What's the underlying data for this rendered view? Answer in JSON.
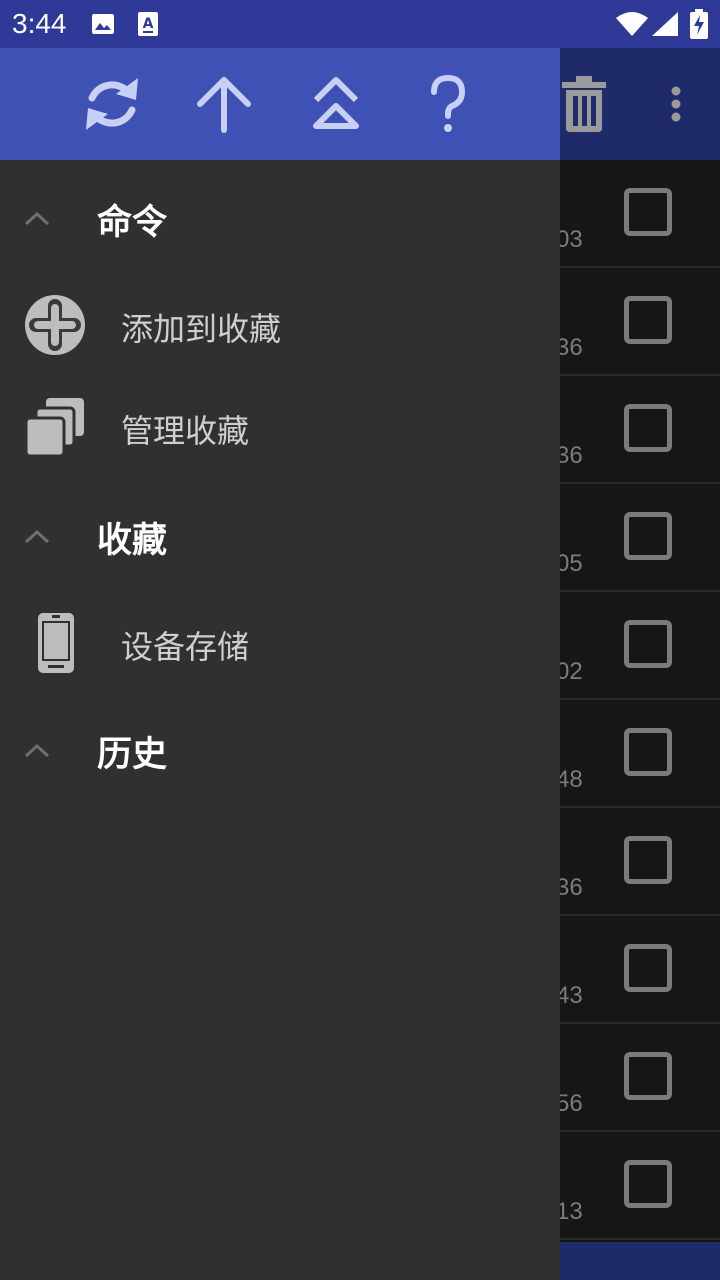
{
  "status_bar": {
    "time": "3:44",
    "left_icons": [
      "image-icon",
      "a-keyboard-icon"
    ],
    "right_icons": [
      "wifi-icon",
      "signal-icon",
      "battery-charging-icon"
    ]
  },
  "drawer": {
    "toolbar_icons": [
      "refresh-icon",
      "arrow-up-icon",
      "double-chevron-up-icon",
      "help-icon"
    ],
    "sections": [
      {
        "title": "命令",
        "items": [
          {
            "label": "添加到收藏",
            "icon": "add-circle-icon"
          },
          {
            "label": "管理收藏",
            "icon": "copy-stack-icon"
          }
        ]
      },
      {
        "title": "收藏",
        "items": [
          {
            "label": "设备存储",
            "icon": "phone-icon"
          }
        ]
      },
      {
        "title": "历史",
        "items": []
      }
    ]
  },
  "background": {
    "appbar_icons": [
      "trash-icon",
      "more-vert-icon"
    ],
    "rows": [
      {
        "partial_value": "03"
      },
      {
        "partial_value": "36"
      },
      {
        "partial_value": "36"
      },
      {
        "partial_value": "05"
      },
      {
        "partial_value": "02"
      },
      {
        "partial_value": "48"
      },
      {
        "partial_value": "36"
      },
      {
        "partial_value": "43"
      },
      {
        "partial_value": "56"
      },
      {
        "partial_value": "13"
      }
    ]
  },
  "colors": {
    "status_bar": "#2f3a98",
    "drawer_toolbar": "#3f51b5",
    "drawer_bg": "#303030",
    "app_bar": "#1f2a6b"
  }
}
